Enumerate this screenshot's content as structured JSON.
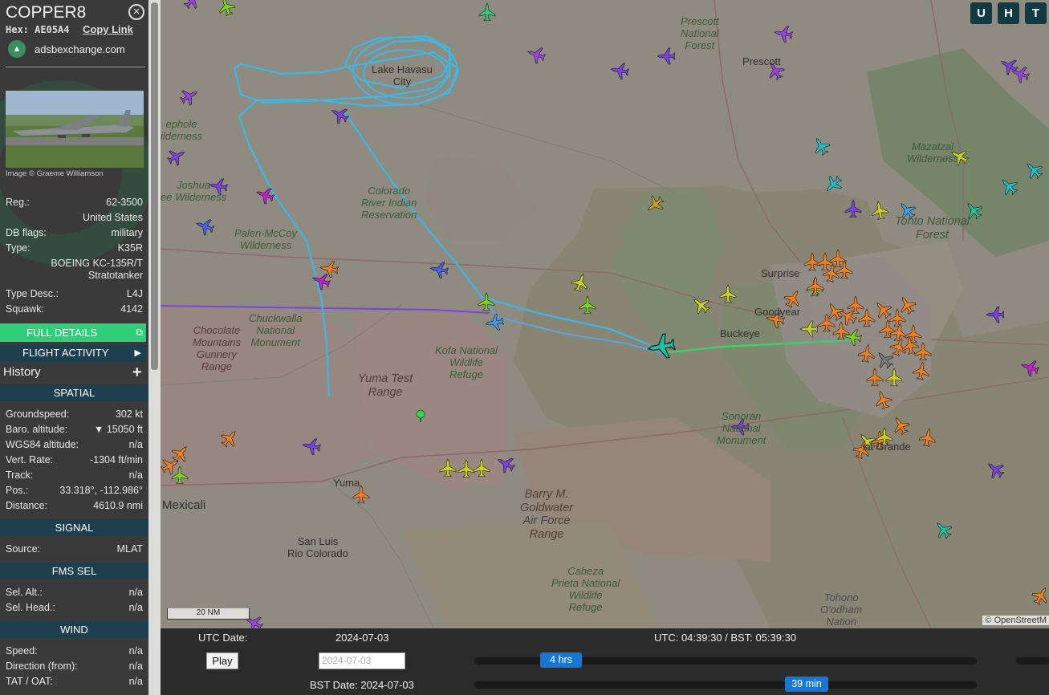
{
  "aircraft": {
    "callsign": "COPPER8",
    "hex_label": "Hex:",
    "hex": "AE05A4",
    "copy_link": "Copy Link",
    "source_site": "adsbexchange.com",
    "image_credit": "Image © Graeme Williamson"
  },
  "details": {
    "reg_label": "Reg.:",
    "reg": "62-3500",
    "country": "United States",
    "dbflags_label": "DB flags:",
    "dbflags": "military",
    "type_label": "Type:",
    "type": "K35R",
    "type_name_1": "BOEING KC-135R/T",
    "type_name_2": "Stratotanker",
    "typedesc_label": "Type Desc.:",
    "typedesc": "L4J",
    "squawk_label": "Squawk:",
    "squawk": "4142"
  },
  "buttons": {
    "full_details": "FULL DETAILS",
    "flight_activity": "FLIGHT ACTIVITY",
    "history": "History"
  },
  "sections": {
    "spatial": "SPATIAL",
    "signal": "SIGNAL",
    "fms": "FMS SEL",
    "wind": "WIND"
  },
  "spatial": {
    "gs_label": "Groundspeed:",
    "gs": "302 kt",
    "baro_label": "Baro. altitude:",
    "baro": "▼ 15050 ft",
    "wgs_label": "WGS84 altitude:",
    "wgs": "n/a",
    "vr_label": "Vert. Rate:",
    "vr": "-1304 ft/min",
    "track_label": "Track:",
    "track": "n/a",
    "pos_label": "Pos.:",
    "pos": "33.318°, -112.986°",
    "dist_label": "Distance:",
    "dist": "4610.9 nmi"
  },
  "signal": {
    "source_label": "Source:",
    "source": "MLAT"
  },
  "fms": {
    "alt_label": "Sel. Alt.:",
    "alt": "n/a",
    "head_label": "Sel. Head.:",
    "head": "n/a"
  },
  "wind": {
    "speed_label": "Speed:",
    "speed": "n/a",
    "dir_label": "Direction (from):",
    "dir": "n/a",
    "tat_label": "TAT / OAT:",
    "tat": "n/a"
  },
  "map": {
    "buttons": [
      "U",
      "H",
      "T"
    ],
    "scale": "20 NM",
    "attribution": "© OpenStreetM",
    "labels": {
      "prescott_nf": "Prescott\nNational\nForest",
      "prescott": "Prescott",
      "lake_havasu": "Lake Havasu\nCity",
      "chemehuevi": "ephole\nilderness",
      "joshua": "Joshua\nee Wilderness",
      "colorado": "Colorado\nRiver Indian\nReservation",
      "palen": "Palen-McCoy\nWilderness",
      "mazatzal": "Mazatzal\nWilderness",
      "tonto": "Tonto National\nForest",
      "surprise": "Surprise",
      "goodyear": "Goodyear",
      "buckeye": "Buckeye",
      "chocolate": "Chocolate\nMountains\nGunnery\nRange",
      "chuckwalla": "Chuckwalla\nNational\nMonument",
      "kofa": "Kofa National\nWildlife\nRefuge",
      "yuma_test": "Yuma Test\nRange",
      "sonoran": "Sonoran\nNational\nMonument",
      "casa_grande": "sa Grande",
      "yuma": "Yuma",
      "mexicali": "Mexicali",
      "barry": "Barry M.\nGoldwater\nAir Force\nRange",
      "san_luis": "San Luis\nRio Colorado",
      "cabeza": "Cabeza\nPrieta National\nWildlife\nRefuge",
      "tohono": "Tohono\nO'odham\nNation"
    }
  },
  "timeline": {
    "utc_date_label": "UTC Date:",
    "utc_date": "2024-07-03",
    "utc_time": "UTC: 04:39:30 / BST: 05:39:30",
    "play": "Play",
    "date_input_placeholder": "2024-07-03",
    "bst_date": "BST Date: 2024-07-03",
    "hrs": "4 hrs",
    "min": "39 min"
  },
  "colors": {
    "track_blue": "#3cb8e6",
    "selected_green": "#2fcf79",
    "panel_bar": "#1e3f4e"
  }
}
